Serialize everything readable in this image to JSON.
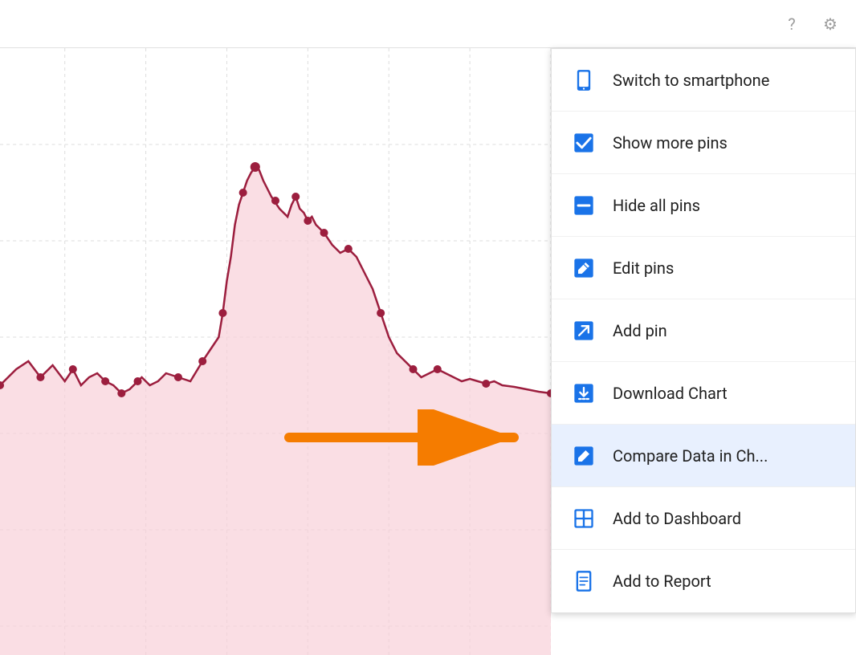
{
  "topbar": {
    "help_icon": "?",
    "settings_icon": "⚙"
  },
  "menu": {
    "items": [
      {
        "id": "switch-smartphone",
        "label": "Switch to smartphone",
        "icon": "smartphone",
        "highlighted": false
      },
      {
        "id": "show-more-pins",
        "label": "Show more pins",
        "icon": "checkbox-checked",
        "highlighted": false
      },
      {
        "id": "hide-all-pins",
        "label": "Hide all pins",
        "icon": "minus-square",
        "highlighted": false
      },
      {
        "id": "edit-pins",
        "label": "Edit pins",
        "icon": "edit-pin",
        "highlighted": false
      },
      {
        "id": "add-pin",
        "label": "Add pin",
        "icon": "add-pin",
        "highlighted": false
      },
      {
        "id": "download-chart",
        "label": "Download Chart",
        "icon": "download",
        "highlighted": false
      },
      {
        "id": "compare-data",
        "label": "Compare Data in Ch...",
        "icon": "compare",
        "highlighted": true
      },
      {
        "id": "add-dashboard",
        "label": "Add to Dashboard",
        "icon": "dashboard",
        "highlighted": false
      },
      {
        "id": "add-report",
        "label": "Add to Report",
        "icon": "report",
        "highlighted": false
      }
    ]
  },
  "colors": {
    "accent": "#1565C0",
    "icon_blue": "#1a73e8",
    "chart_line": "#9c1e3e",
    "chart_fill": "#f8d7da",
    "highlight_bg": "#e8f0fe",
    "arrow": "#f57c00"
  }
}
